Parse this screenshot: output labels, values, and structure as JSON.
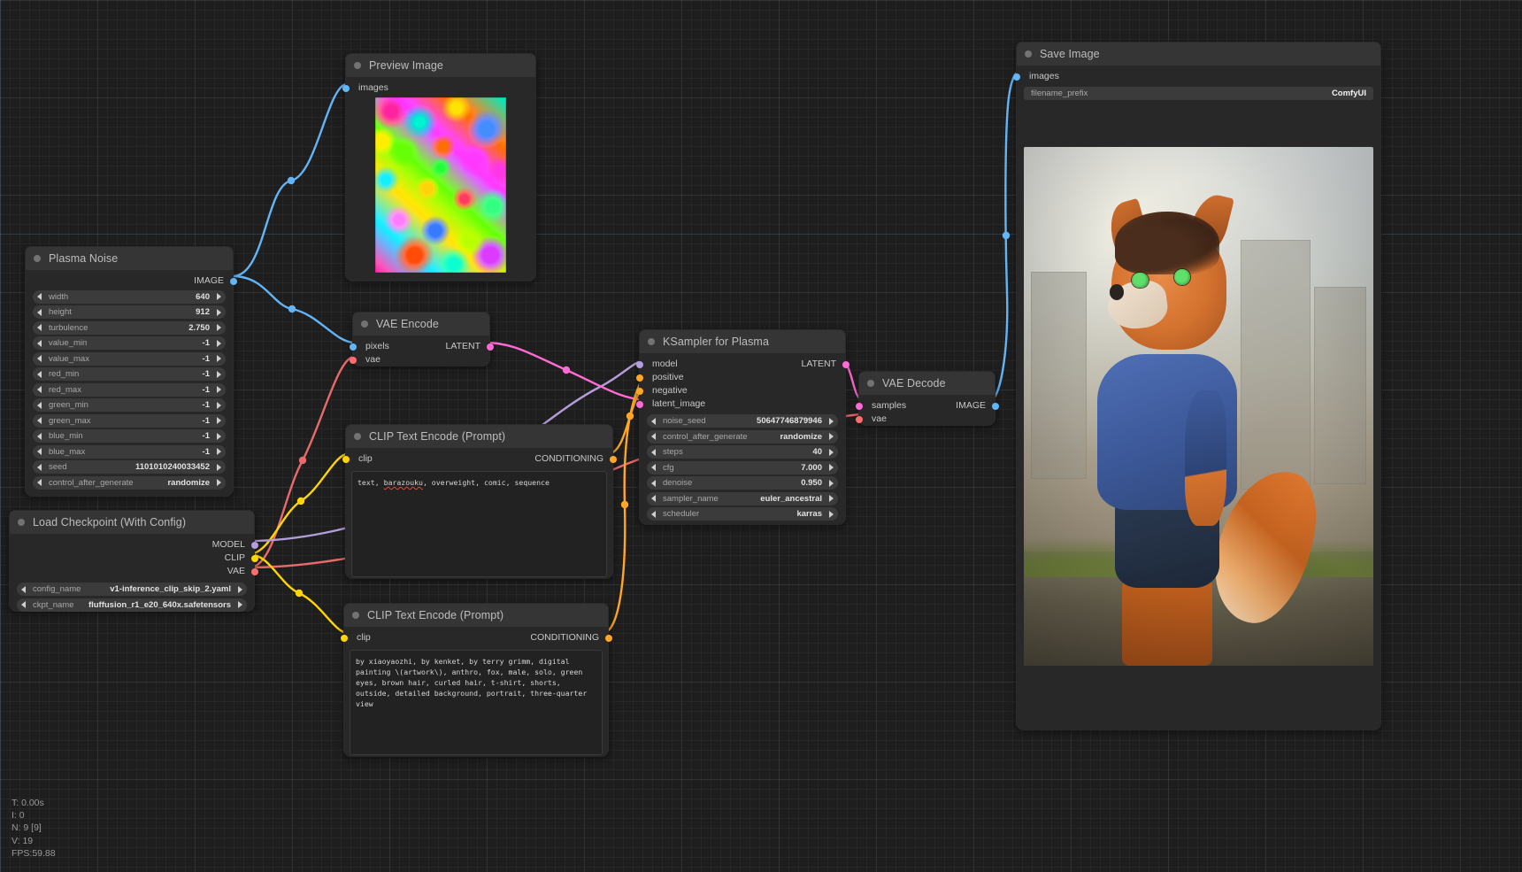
{
  "app": "ComfyUI node graph",
  "colors": {
    "image_port": "#64b5f6",
    "latent_port": "#ff6bd6",
    "model_port": "#b39ddb",
    "clip_port": "#ffd600",
    "vae_port": "#ff6e6e",
    "conditioning_port": "#ffa726",
    "node_header": "#353535",
    "node_body": "#282828",
    "canvas": "#1e1e1e"
  },
  "nodes": {
    "preview_image": {
      "title": "Preview Image",
      "inputs": [
        {
          "name": "images",
          "type": "IMAGE"
        }
      ],
      "image_alt": "plasma noise preview"
    },
    "plasma_noise": {
      "title": "Plasma Noise",
      "outputs": [
        {
          "name": "IMAGE",
          "type": "IMAGE"
        }
      ],
      "widgets": [
        {
          "name": "width",
          "value": "640"
        },
        {
          "name": "height",
          "value": "912"
        },
        {
          "name": "turbulence",
          "value": "2.750"
        },
        {
          "name": "value_min",
          "value": "-1"
        },
        {
          "name": "value_max",
          "value": "-1"
        },
        {
          "name": "red_min",
          "value": "-1"
        },
        {
          "name": "red_max",
          "value": "-1"
        },
        {
          "name": "green_min",
          "value": "-1"
        },
        {
          "name": "green_max",
          "value": "-1"
        },
        {
          "name": "blue_min",
          "value": "-1"
        },
        {
          "name": "blue_max",
          "value": "-1"
        },
        {
          "name": "seed",
          "value": "1101010240033452"
        },
        {
          "name": "control_after_generate",
          "value": "randomize"
        }
      ]
    },
    "vae_encode": {
      "title": "VAE Encode",
      "inputs": [
        {
          "name": "pixels",
          "type": "IMAGE"
        },
        {
          "name": "vae",
          "type": "VAE"
        }
      ],
      "outputs": [
        {
          "name": "LATENT",
          "type": "LATENT"
        }
      ]
    },
    "load_checkpoint": {
      "title": "Load Checkpoint (With Config)",
      "outputs": [
        {
          "name": "MODEL",
          "type": "MODEL"
        },
        {
          "name": "CLIP",
          "type": "CLIP"
        },
        {
          "name": "VAE",
          "type": "VAE"
        }
      ],
      "widgets": [
        {
          "name": "config_name",
          "value": "v1-inference_clip_skip_2.yaml"
        },
        {
          "name": "ckpt_name",
          "value": "fluffusion_r1_e20_640x.safetensors"
        }
      ]
    },
    "clip_negative": {
      "title": "CLIP Text Encode (Prompt)",
      "inputs": [
        {
          "name": "clip",
          "type": "CLIP"
        }
      ],
      "outputs": [
        {
          "name": "CONDITIONING",
          "type": "CONDITIONING"
        }
      ],
      "text_before": "text, ",
      "text_misspelled": "barazouku",
      "text_after": ", overweight, comic, sequence",
      "text": "text, barazouku, overweight, comic, sequence"
    },
    "clip_positive": {
      "title": "CLIP Text Encode (Prompt)",
      "inputs": [
        {
          "name": "clip",
          "type": "CLIP"
        }
      ],
      "outputs": [
        {
          "name": "CONDITIONING",
          "type": "CONDITIONING"
        }
      ],
      "text": "by xiaoyaozhi, by kenket, by terry grimm, digital painting \\(artwork\\), anthro, fox, male, solo, green eyes, brown hair, curled hair, t-shirt, shorts, outside, detailed background, portrait, three-quarter view"
    },
    "ksampler": {
      "title": "KSampler for Plasma",
      "inputs": [
        {
          "name": "model",
          "type": "MODEL"
        },
        {
          "name": "positive",
          "type": "CONDITIONING"
        },
        {
          "name": "negative",
          "type": "CONDITIONING"
        },
        {
          "name": "latent_image",
          "type": "LATENT"
        }
      ],
      "outputs": [
        {
          "name": "LATENT",
          "type": "LATENT"
        }
      ],
      "widgets": [
        {
          "name": "noise_seed",
          "value": "50647746879946"
        },
        {
          "name": "control_after_generate",
          "value": "randomize"
        },
        {
          "name": "steps",
          "value": "40"
        },
        {
          "name": "cfg",
          "value": "7.000"
        },
        {
          "name": "denoise",
          "value": "0.950"
        },
        {
          "name": "sampler_name",
          "value": "euler_ancestral"
        },
        {
          "name": "scheduler",
          "value": "karras"
        }
      ]
    },
    "vae_decode": {
      "title": "VAE Decode",
      "inputs": [
        {
          "name": "samples",
          "type": "LATENT"
        },
        {
          "name": "vae",
          "type": "VAE"
        }
      ],
      "outputs": [
        {
          "name": "IMAGE",
          "type": "IMAGE"
        }
      ]
    },
    "save_image": {
      "title": "Save Image",
      "inputs": [
        {
          "name": "images",
          "type": "IMAGE"
        }
      ],
      "widgets": [
        {
          "name": "filename_prefix",
          "value": "ComfyUI"
        }
      ],
      "image_alt": "anthro fox character digital painting"
    }
  },
  "stats": {
    "time": "T: 0.00s",
    "iterations": "I: 0",
    "nodes": "N: 9 [9]",
    "vertices": "V: 19",
    "fps": "FPS:59.88"
  }
}
